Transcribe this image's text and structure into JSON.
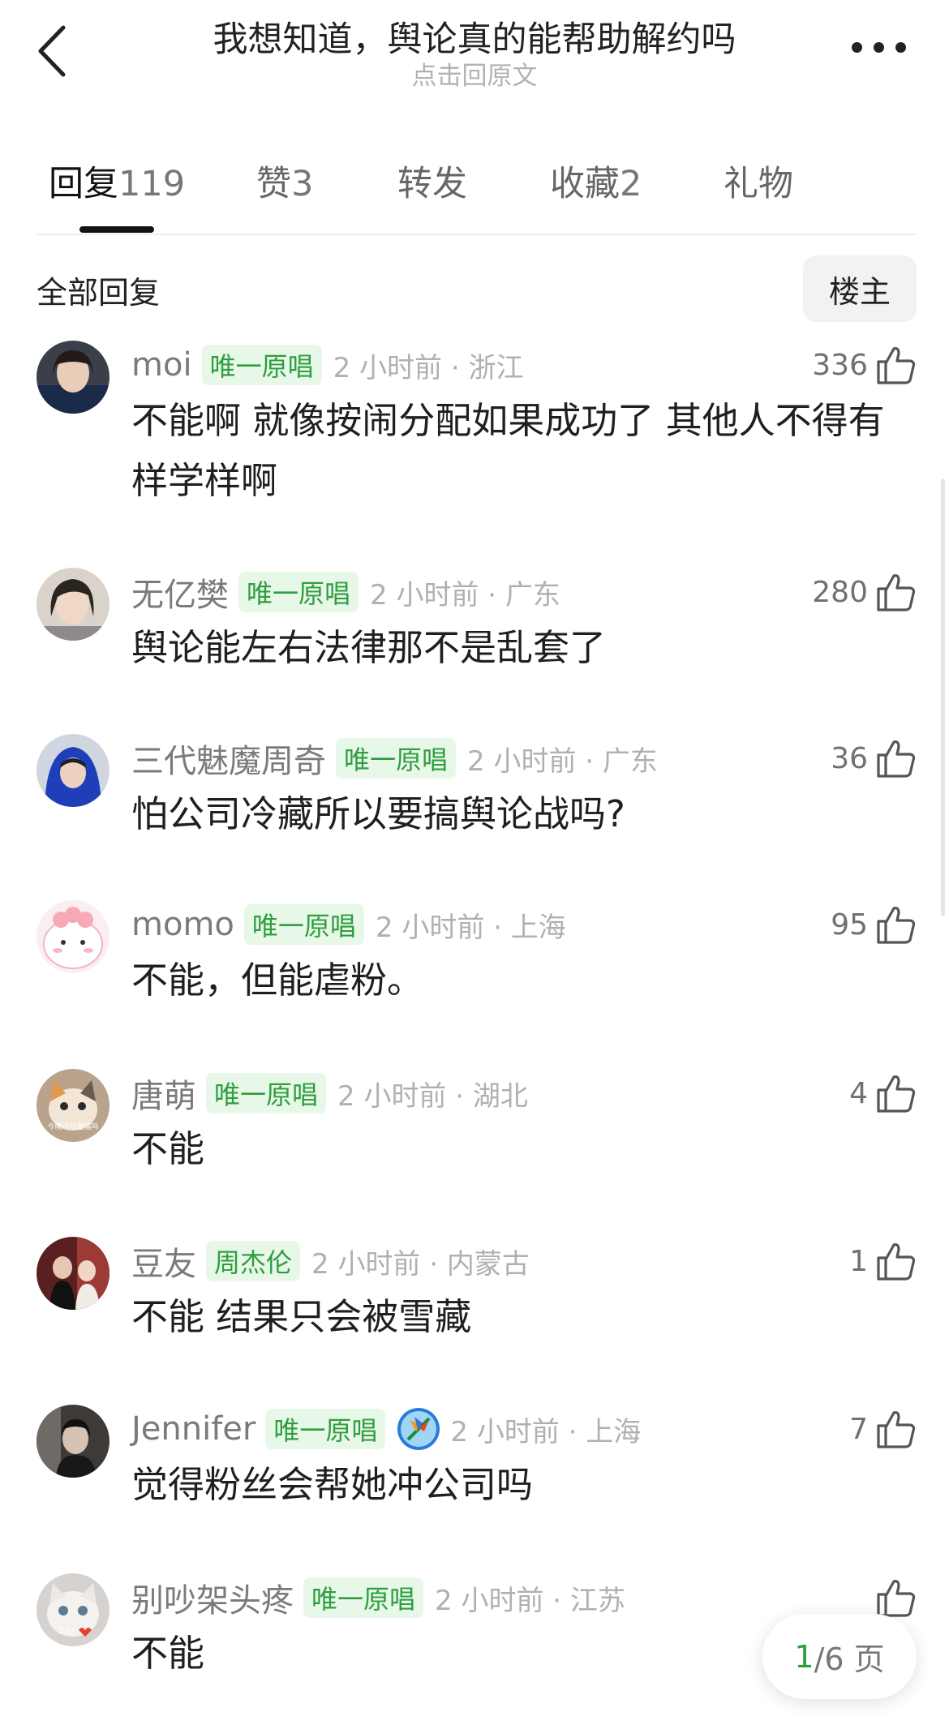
{
  "header": {
    "title": "我想知道，舆论真的能帮助解约吗",
    "subtitle": "点击回原文"
  },
  "tabs": [
    {
      "label": "回复",
      "count": "119"
    },
    {
      "label": "赞",
      "count": "3"
    },
    {
      "label": "转发",
      "count": ""
    },
    {
      "label": "收藏",
      "count": "2"
    },
    {
      "label": "礼物",
      "count": ""
    }
  ],
  "section": {
    "title": "全部回复",
    "owner_button": "楼主"
  },
  "comments": [
    {
      "username": "moi",
      "badge": "唯一原唱",
      "time": "2 小时前 · 浙江",
      "likes": "336",
      "text": "不能啊 就像按闹分配如果成功了 其他人不得有样学样啊"
    },
    {
      "username": "无亿樊",
      "badge": "唯一原唱",
      "time": "2 小时前 · 广东",
      "likes": "280",
      "text": "舆论能左右法律那不是乱套了"
    },
    {
      "username": "三代魅魔周奇",
      "badge": "唯一原唱",
      "time": "2 小时前 · 广东",
      "likes": "36",
      "text": "怕公司冷藏所以要搞舆论战吗?"
    },
    {
      "username": "momo",
      "badge": "唯一原唱",
      "time": "2 小时前 · 上海",
      "likes": "95",
      "text": "不能，但能虐粉。"
    },
    {
      "username": "唐萌",
      "badge": "唯一原唱",
      "time": "2 小时前 · 湖北",
      "likes": "4",
      "text": "不能"
    },
    {
      "username": "豆友",
      "badge": "周杰伦",
      "time": "2 小时前 · 内蒙古",
      "likes": "1",
      "text": "不能 结果只会被雪藏"
    },
    {
      "username": "Jennifer",
      "badge": "唯一原唱",
      "time": "2 小时前 · 上海",
      "likes": "7",
      "text": "觉得粉丝会帮她冲公司吗"
    },
    {
      "username": "别吵架头疼",
      "badge": "唯一原唱",
      "time": "2 小时前 · 江苏",
      "likes": "",
      "text": "不能"
    }
  ],
  "avatar_texts": {
    "tang": "今晚可以遛猫吗",
    "cat": "比心"
  },
  "pager": {
    "current": "1",
    "rest": "/6 页"
  },
  "colors": {
    "badge_green": "#2e9e3e",
    "badge_bg": "#e7f7e8"
  }
}
